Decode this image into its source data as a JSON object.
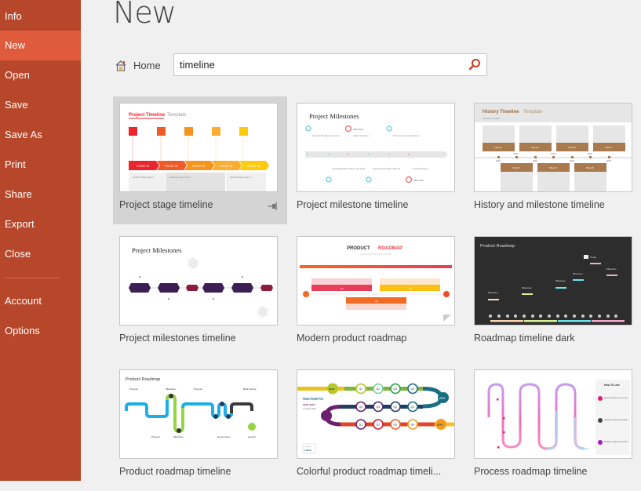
{
  "sidebar": {
    "items": [
      {
        "label": "Info"
      },
      {
        "label": "New",
        "active": true
      },
      {
        "label": "Open"
      },
      {
        "label": "Save"
      },
      {
        "label": "Save As"
      },
      {
        "label": "Print"
      },
      {
        "label": "Share"
      },
      {
        "label": "Export"
      },
      {
        "label": "Close"
      },
      {
        "label": "Account"
      },
      {
        "label": "Options"
      }
    ]
  },
  "header": {
    "title": "New",
    "home_label": "Home",
    "search_value": "timeline"
  },
  "templates": [
    {
      "label": "Project stage timeline",
      "selected": true,
      "thumb": {
        "title_accent": "Project Timeline",
        "title_rest": "Template",
        "stages": [
          "STAGE 01",
          "STAGE 02",
          "STAGE 03",
          "STAGE 04",
          "STAGE 05"
        ],
        "box_text": "Additional Stage Title 01"
      }
    },
    {
      "label": "Project milestone timeline",
      "thumb": {
        "title": "Project Milestones",
        "top_notes": [
          "Financial Planning Commences",
          "Initial Subscribers",
          "NYC Launches on all Markets"
        ],
        "bottom_notes": [
          "Beta Registration Opens to the Public",
          "Advertising Campaign Kicks Off",
          "Final Subscribers"
        ],
        "subs_label": "200 Subs"
      }
    },
    {
      "label": "History and milestone timeline",
      "thumb": {
        "title_accent": "History Timeline",
        "title_rest": "Template",
        "subtitle": "Timeline Subtitle",
        "top_titles": [
          "Title 01",
          "Title 03",
          "Title 05",
          "Title 07"
        ],
        "bottom_titles": [
          "Title 02",
          "Title 04",
          "Title 06"
        ],
        "year": "20XX"
      }
    },
    {
      "label": "Project milestones timeline",
      "thumb": {
        "title": "Project Milestones"
      }
    },
    {
      "label": "Modern product roadmap",
      "thumb": {
        "title_a": "PRODUCT",
        "title_b": "ROADMAP",
        "bars": [
          "Q1",
          "Q3",
          "Q2"
        ]
      }
    },
    {
      "label": "Roadmap timeline dark",
      "thumb": {
        "title": "Product Roadmap",
        "milestone": "Milestone",
        "today": "Today"
      }
    },
    {
      "label": "Product roadmap timeline",
      "thumb": {
        "title": "Product Roadmap",
        "labels_top": [
          "Process",
          "Milestone",
          "Process",
          "Beta Testing"
        ],
        "labels_bottom": [
          "Process",
          "Milestone",
          "Group Items",
          "Launch"
        ]
      }
    },
    {
      "label": "Colorful product roadmap timeli...",
      "thumb": {
        "title": "PRODUCT ROADMAP TITLE",
        "years": "20XX-20XX",
        "plan": "3 Years Plan",
        "logo": "LOGO",
        "logo_sub": "Company",
        "year_badge": "20XX",
        "row1": [
          "Q1",
          "Q2",
          "Q3",
          "Q4"
        ],
        "row2": [
          "Q4",
          "Q3",
          "Q2",
          "Q1"
        ],
        "row3": [
          "Q1",
          "Q2",
          "Q3",
          "Q4"
        ]
      }
    },
    {
      "label": "Process roadmap timeline",
      "thumb": {
        "howto_title": "How To Use",
        "steps": [
          "Delete the lines and text you don't need",
          "Update the milestones and dates",
          "Optional: Update the colors"
        ]
      }
    }
  ],
  "colors": {
    "sidebar_bg": "#b7472a",
    "sidebar_active": "#e05b3c",
    "search_icon": "#c43e1c"
  }
}
